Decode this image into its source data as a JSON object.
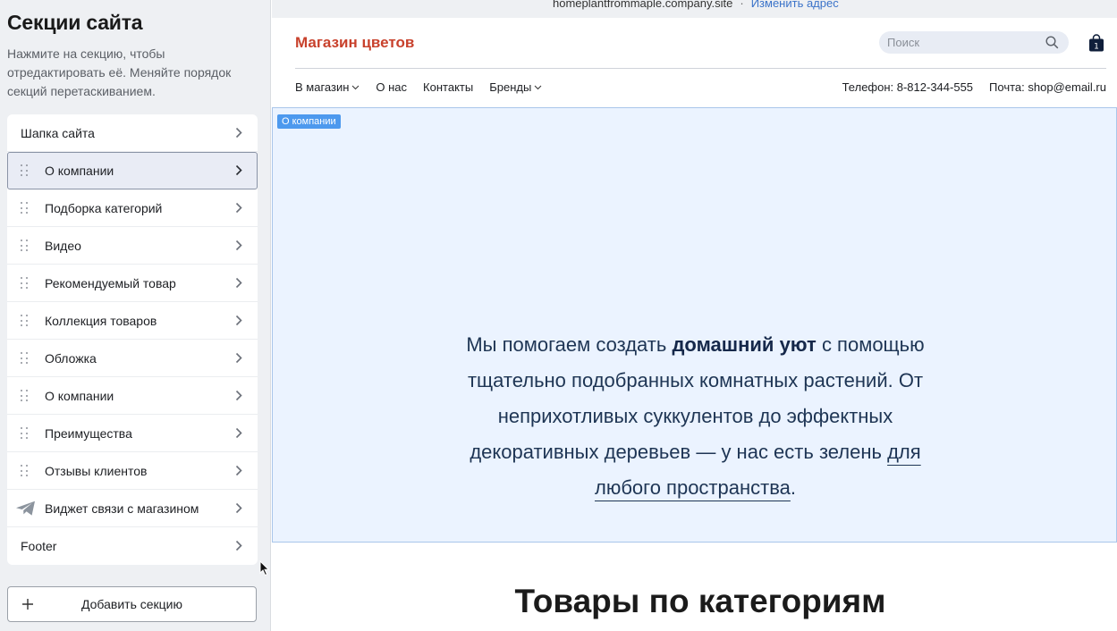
{
  "sidebar": {
    "title": "Секции сайта",
    "description": "Нажмите на секцию, чтобы отредактировать её. Меняйте порядок секций перетаскиванием.",
    "items": [
      {
        "label": "Шапка сайта"
      },
      {
        "label": "О компании"
      },
      {
        "label": "Подборка категорий"
      },
      {
        "label": "Видео"
      },
      {
        "label": "Рекомендуемый товар"
      },
      {
        "label": "Коллекция товаров"
      },
      {
        "label": "Обложка"
      },
      {
        "label": "О компании"
      },
      {
        "label": "Преимущества"
      },
      {
        "label": "Отзывы клиентов"
      },
      {
        "label": "Виджет связи с магазином"
      },
      {
        "label": "Footer"
      }
    ],
    "add_button": "Добавить секцию"
  },
  "preview": {
    "url": "homeplantfrommaple.company.site",
    "change_address": "Изменить адрес",
    "store_name": "Магазин цветов",
    "search_placeholder": "Поиск",
    "cart_count": "1",
    "nav": [
      "В магазин",
      "О нас",
      "Контакты",
      "Бренды"
    ],
    "phone": "Телефон: 8-812-344-555",
    "email": "Почта: shop@email.ru",
    "section_tag": "О компании",
    "about": {
      "part1": "Мы помогаем создать ",
      "bold": "домашний уют",
      "part2": " с помощью тщательно подобранных комнатных растений. От неприхотливых суккулентов до эффектных декоративных деревьев — у нас есть зелень ",
      "underlined": "для любого пространства",
      "part3": "."
    },
    "categories_title": "Товары по категориям"
  },
  "colors": {
    "brand": "#c8412c",
    "link": "#3b73c9",
    "selection": "#4d99ee",
    "about_bg": "#ebf3ff"
  }
}
